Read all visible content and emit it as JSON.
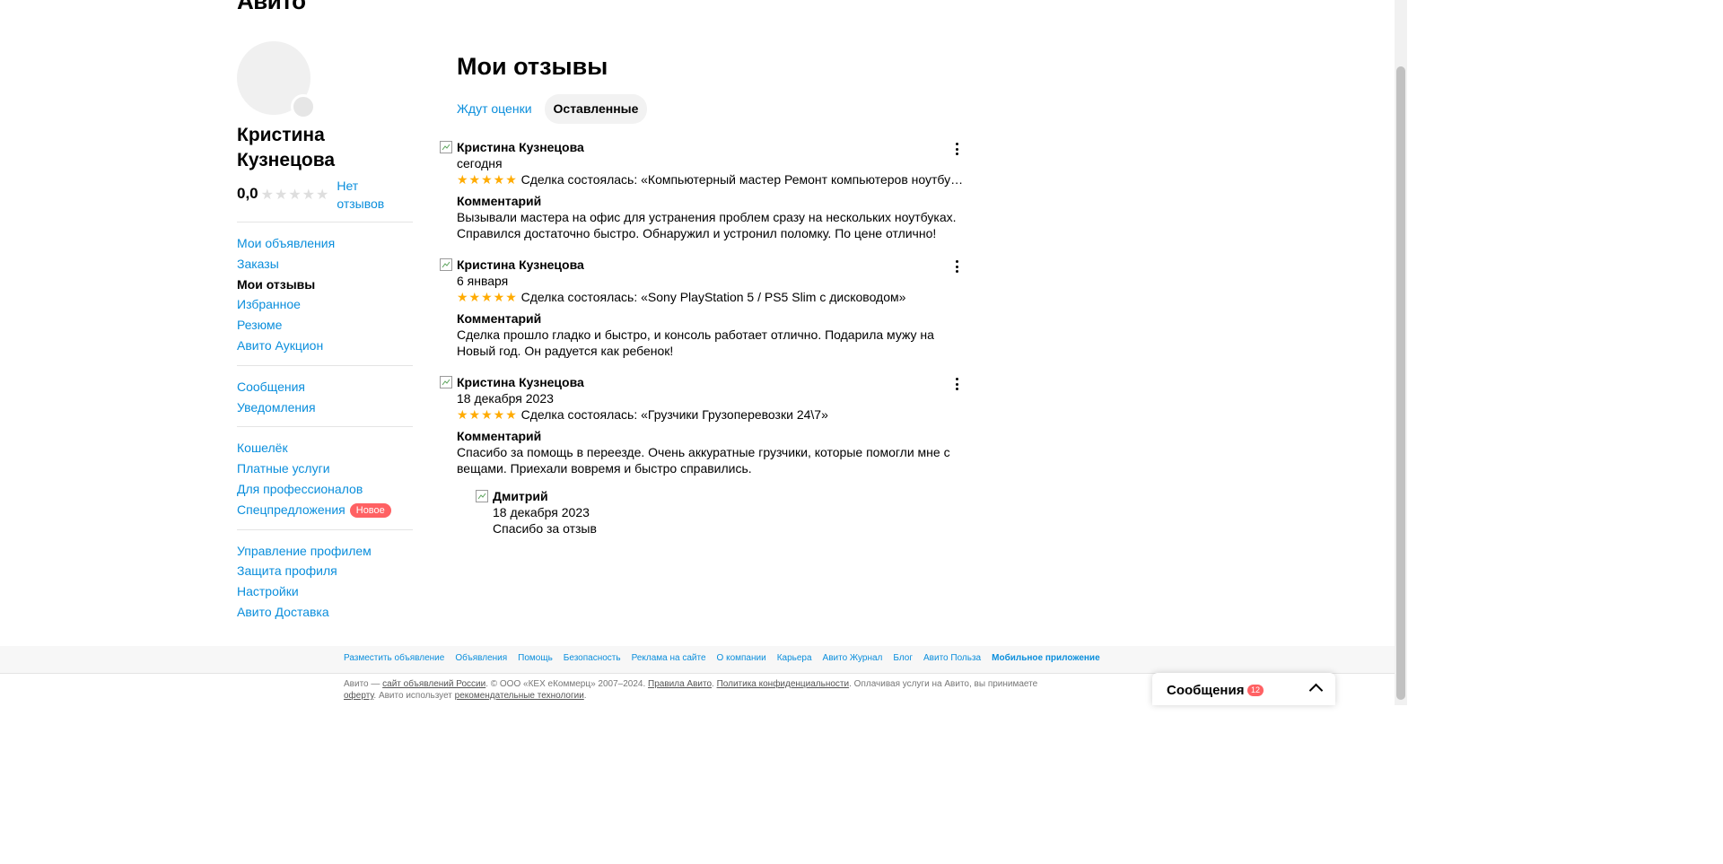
{
  "header": {
    "logo": "Авито"
  },
  "profile": {
    "name": "Кристина Кузнецова",
    "rating": "0,0",
    "rating_stars": "★★★★★",
    "no_reviews": "Нет отзывов"
  },
  "sidebar": {
    "group1": [
      {
        "label": "Мои объявления"
      },
      {
        "label": "Заказы"
      },
      {
        "label": "Мои отзывы"
      },
      {
        "label": "Избранное"
      },
      {
        "label": "Резюме"
      },
      {
        "label": "Авито Аукцион"
      }
    ],
    "group2": [
      {
        "label": "Сообщения"
      },
      {
        "label": "Уведомления"
      }
    ],
    "group3": [
      {
        "label": "Кошелёк"
      },
      {
        "label": "Платные услуги"
      },
      {
        "label": "Для профессионалов"
      },
      {
        "label": "Спецпредложения"
      }
    ],
    "new_badge": "Новое",
    "group4": [
      {
        "label": "Управление профилем"
      },
      {
        "label": "Защита профиля"
      },
      {
        "label": "Настройки"
      },
      {
        "label": "Авито Доставка"
      }
    ]
  },
  "main": {
    "title": "Мои отзывы",
    "tabs": [
      {
        "label": "Ждут оценки"
      },
      {
        "label": "Оставленные"
      }
    ],
    "comment_label": "Комментарий",
    "rating_stars": "★★★★★",
    "reviews": [
      {
        "author": "Кристина Кузнецова",
        "date": "сегодня",
        "rating": 5,
        "deal": "Сделка состоялась: «Компьютерный мастер Ремонт компьютеров ноутбуков»",
        "comment": "Вызывали мастера на офис для устранения проблем сразу на нескольких ноутбуках. Справился достаточно быстро. Обнаружил и устронил поломку. По цене отлично!"
      },
      {
        "author": "Кристина Кузнецова",
        "date": "6 января",
        "rating": 5,
        "deal": "Сделка состоялась: «Sony PlayStation 5 / PS5 Slim с дисководом»",
        "comment": "Сделка прошло гладко и быстро, и консоль работает отлично. Подарила мужу на Новый год. Он радуется как ребенок!"
      },
      {
        "author": "Кристина Кузнецова",
        "date": "18 декабря 2023",
        "rating": 5,
        "deal": "Сделка состоялась: «Грузчики Грузоперевозки 24\\7»",
        "comment": "Спасибо за помощь в переезде. Очень аккуратные грузчики, которые помогли мне с вещами. Приехали вовремя и быстро справились.",
        "reply": {
          "author": "Дмитрий",
          "date": "18 декабря 2023",
          "text": "Спасибо за отзыв"
        }
      }
    ]
  },
  "footer": {
    "links": [
      "Разместить объявление",
      "Объявления",
      "Помощь",
      "Безопасность",
      "Реклама на сайте",
      "О компании",
      "Карьера",
      "Авито Журнал",
      "Блог",
      "Авито Польза",
      "Мобильное приложение"
    ],
    "legal": {
      "p1": "Авито — ",
      "l1": "сайт объявлений России",
      "p2": ". © ООО «КЕХ еКоммерц» 2007–2024. ",
      "l2": "Правила Авито",
      "p3": ". ",
      "l3": "Политика конфиденциальности",
      "p4": ". Оплачивая услуги на Авито, вы принимаете ",
      "l4": "оферту",
      "p5": ". Авито использует ",
      "l5": "рекомендательные технологии",
      "p6": "."
    }
  },
  "messages_panel": {
    "label": "Сообщения",
    "count": "12"
  },
  "colors": {
    "link": "#0a8edc",
    "star": "#ffab00",
    "badge": "#ff6163"
  }
}
